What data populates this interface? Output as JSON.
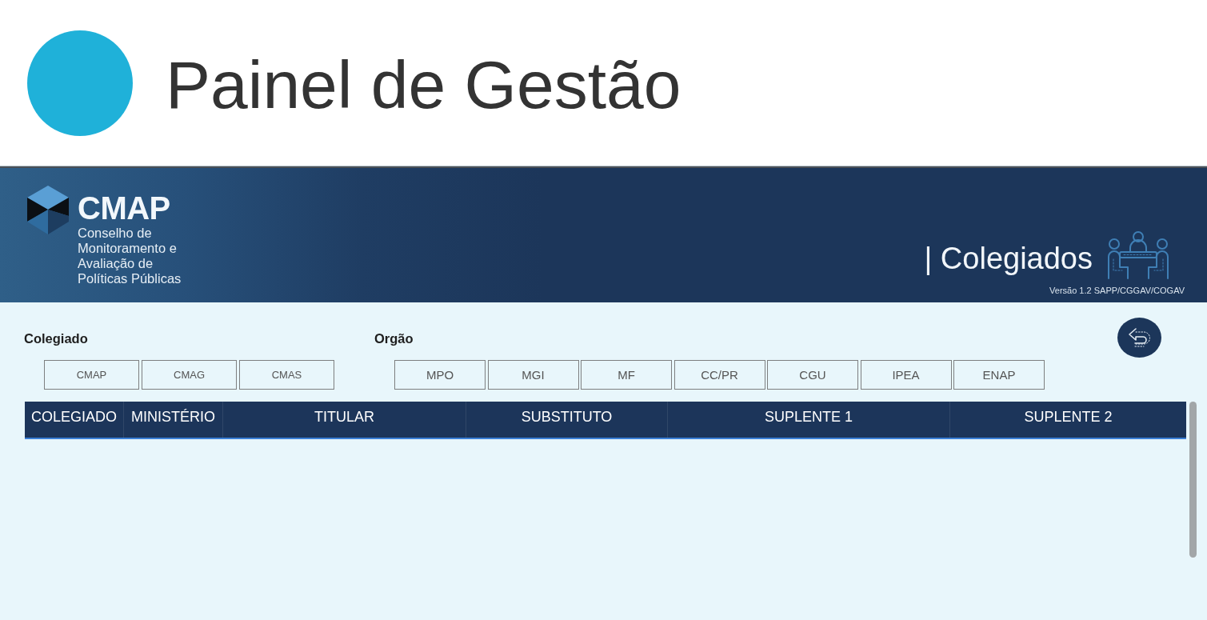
{
  "header": {
    "title": "Painel de Gestão"
  },
  "banner": {
    "brand": {
      "name": "CMAP",
      "subtitle_lines": [
        "Conselho de",
        "Monitoramento e",
        "Avaliação de",
        "Políticas Públicas"
      ]
    },
    "section_title": "| Colegiados",
    "version": "Versão 1.2 SAPP/CGGAV/COGAV"
  },
  "filters": [
    {
      "label": "Colegiado",
      "options": [
        {
          "label": "CMAP",
          "selected": false
        },
        {
          "label": "CMAG",
          "selected": false
        },
        {
          "label": "CMAS",
          "selected": false
        }
      ]
    },
    {
      "label": "Orgão",
      "options": [
        {
          "label": "MPO",
          "selected": false
        },
        {
          "label": "MGI",
          "selected": false
        },
        {
          "label": "MF",
          "selected": false
        },
        {
          "label": "CC/PR",
          "selected": false
        },
        {
          "label": "CGU",
          "selected": false
        },
        {
          "label": "IPEA",
          "selected": false
        },
        {
          "label": "ENAP",
          "selected": false
        }
      ]
    }
  ],
  "table": {
    "columns": [
      "COLEGIADO",
      "MINISTÉRIO",
      "TITULAR",
      "SUBSTITUTO",
      "SUPLENTE 1",
      "SUPLENTE 2"
    ]
  }
}
